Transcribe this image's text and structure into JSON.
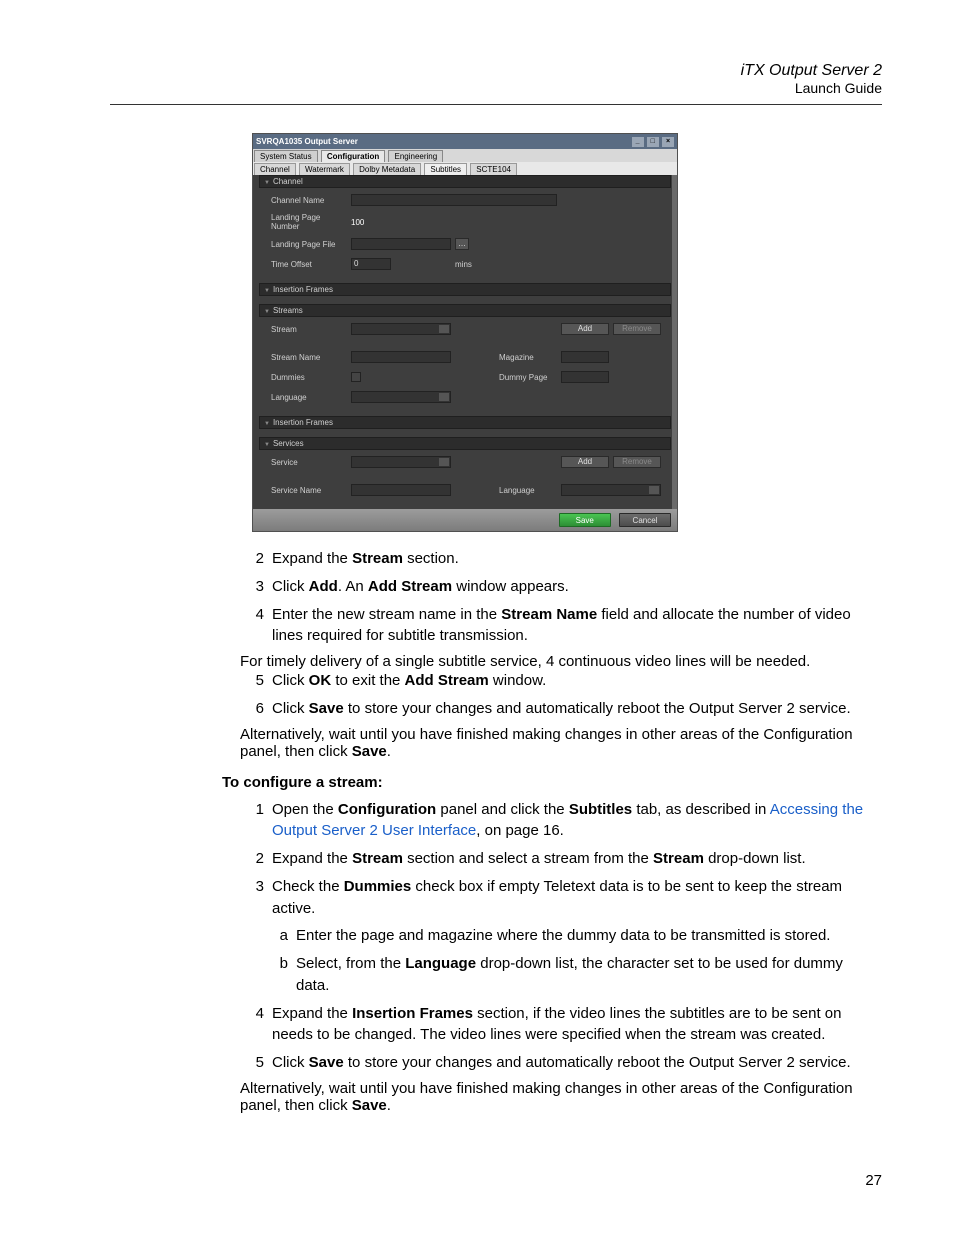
{
  "header": {
    "title": "iTX Output Server 2",
    "subtitle": "Launch Guide"
  },
  "shot": {
    "title": "SVRQA1035 Output Server",
    "toptabs": [
      "System Status",
      "Configuration",
      "Engineering"
    ],
    "subtabs": [
      "Channel",
      "Watermark",
      "Dolby Metadata",
      "Subtitles",
      "SCTE104"
    ],
    "sections": {
      "channel": "Channel",
      "insertion1": "Insertion Frames",
      "streams": "Streams",
      "insertion2": "Insertion Frames",
      "services": "Services"
    },
    "labels": {
      "channel_name": "Channel Name",
      "landing_page_number": "Landing Page Number",
      "landing_page_file": "Landing Page File",
      "time_offset": "Time Offset",
      "mins": "mins",
      "stream": "Stream",
      "stream_name": "Stream Name",
      "dummies": "Dummies",
      "language": "Language",
      "magazine": "Magazine",
      "dummy_page": "Dummy Page",
      "service": "Service",
      "service_name": "Service Name",
      "svc_language": "Language"
    },
    "values": {
      "landing_page_number": "100",
      "time_offset": "0"
    },
    "buttons": {
      "add": "Add",
      "remove": "Remove",
      "save": "Save",
      "cancel": "Cancel"
    }
  },
  "instr1": {
    "s2": "Expand the <b>Stream</b> section.",
    "s3": "Click <b>Add</b>. An <b>Add Stream</b> window appears.",
    "s4": "Enter the new stream name in the <b>Stream Name</b> field and allocate the number of video lines required for subtitle transmission.",
    "s4b": "For timely delivery of a single subtitle service, 4 continuous video lines will be needed.",
    "s5": "Click <b>OK</b> to exit the <b>Add Stream</b> window.",
    "s6": "Click <b>Save</b> to store your changes and automatically reboot the Output Server 2 service.",
    "s6b": "Alternatively, wait until you have finished making changes in other areas of the Configuration panel, then click <b>Save</b>."
  },
  "subheading": "To configure a stream:",
  "instr2": {
    "s1a": "Open the <b>Configuration</b> panel and click the <b>Subtitles</b> tab, as described in ",
    "s1link": "Accessing the Output Server 2 User Interface",
    "s1b": ", on page 16.",
    "s2": "Expand the <b>Stream</b> section and select a stream from the <b>Stream</b> drop-down list.",
    "s3": "Check the <b>Dummies</b> check box if empty Teletext data is to be sent to keep the stream active.",
    "s3a": "Enter the page and magazine where the dummy data to be transmitted is stored.",
    "s3b": "Select, from the <b>Language</b> drop-down list, the character set to be used for dummy data.",
    "s4": "Expand the <b>Insertion Frames</b> section, if the video lines the subtitles are to be sent on needs to be changed. The video lines were specified when the stream was created.",
    "s5": "Click <b>Save</b> to store your changes and automatically reboot the Output Server 2 service.",
    "s5b": "Alternatively, wait until you have finished making changes in other areas of the Configuration panel, then click <b>Save</b>."
  },
  "pagenum": "27"
}
